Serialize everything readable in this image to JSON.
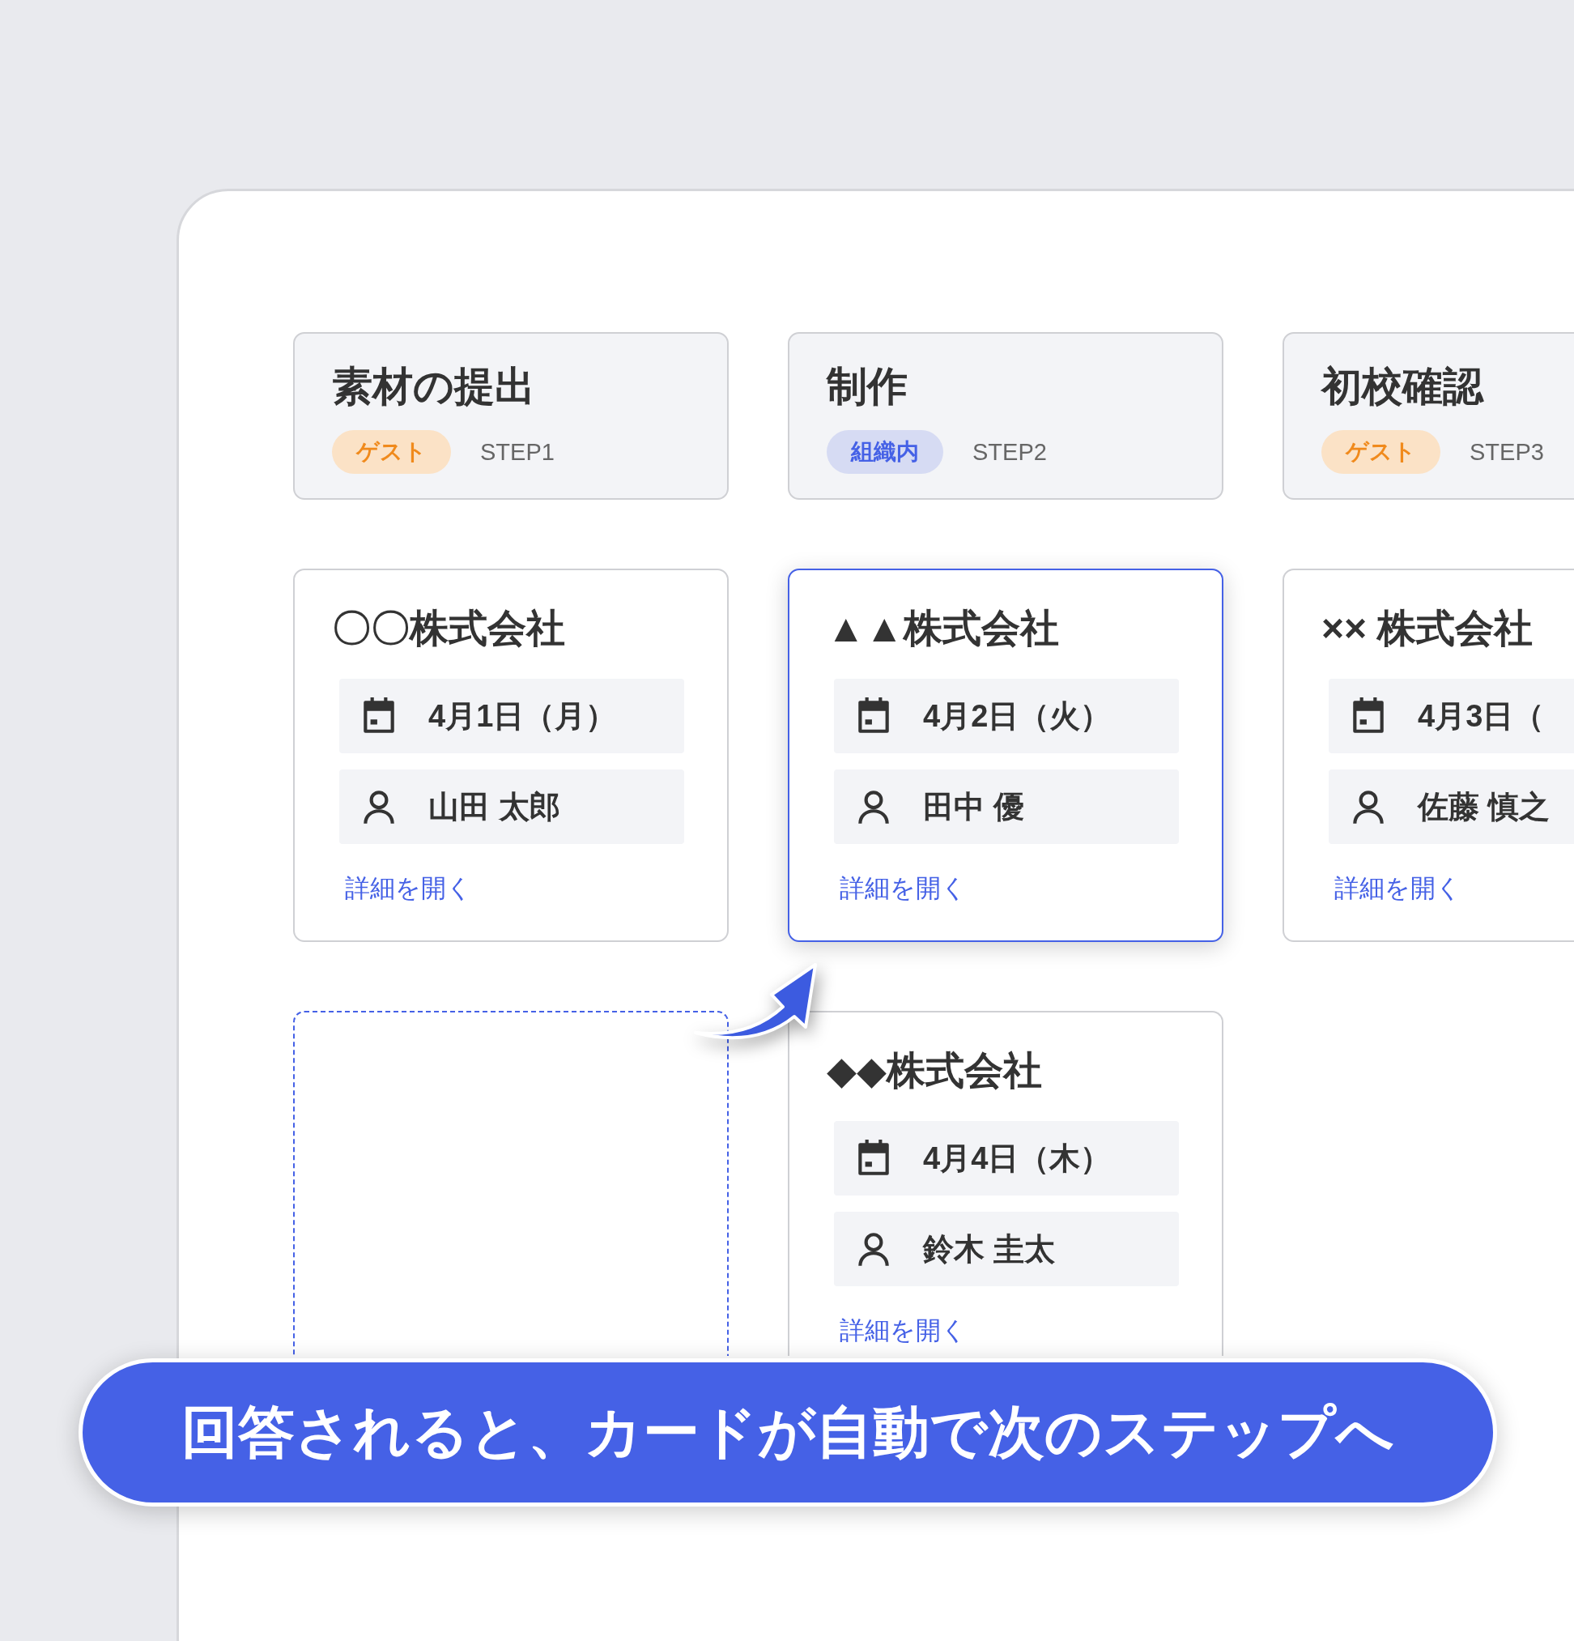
{
  "columns": [
    {
      "title": "素材の提出",
      "badge": {
        "label": "ゲスト",
        "kind": "guest"
      },
      "step": "STEP1",
      "cards": [
        {
          "kind": "card",
          "company": "〇〇株式会社",
          "date": "4月1日（月）",
          "person": "山田 太郎",
          "link": "詳細を開く",
          "selected": false
        },
        {
          "kind": "empty"
        }
      ]
    },
    {
      "title": "制作",
      "badge": {
        "label": "組織内",
        "kind": "internal"
      },
      "step": "STEP2",
      "cards": [
        {
          "kind": "card",
          "company": "▲▲株式会社",
          "date": "4月2日（火）",
          "person": "田中 優",
          "link": "詳細を開く",
          "selected": true
        },
        {
          "kind": "card",
          "company": "◆◆株式会社",
          "date": "4月4日（木）",
          "person": "鈴木 圭太",
          "link": "詳細を開く",
          "selected": false
        }
      ]
    },
    {
      "title": "初校確認",
      "badge": {
        "label": "ゲスト",
        "kind": "guest"
      },
      "step": "STEP3",
      "cards": [
        {
          "kind": "card",
          "company": "×× 株式会社",
          "date": "4月3日（",
          "person": "佐藤 慎之",
          "link": "詳細を開く",
          "selected": false
        }
      ]
    }
  ],
  "caption": "回答されると、カードが自動で次のステップへ"
}
